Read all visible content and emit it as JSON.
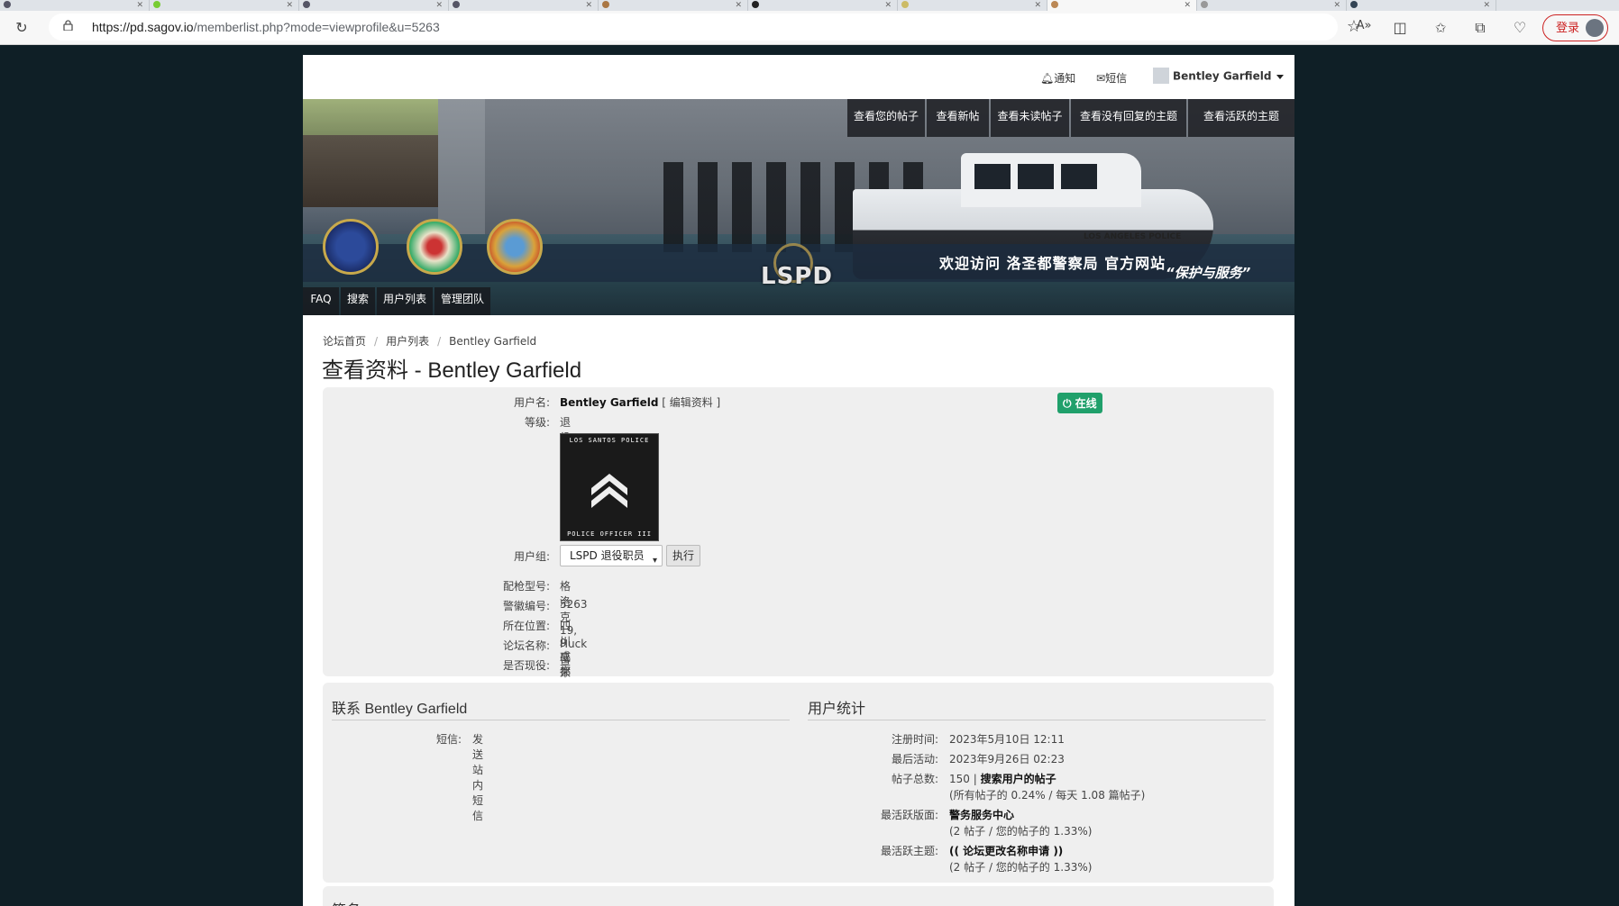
{
  "browser": {
    "url_host": "https://pd.sagov.io",
    "url_path": "/memberlist.php?mode=viewprofile&u=5263",
    "login_label": "登录"
  },
  "topnav": {
    "notifications": "通知",
    "pm": "短信",
    "username": "Bentley Garfield"
  },
  "banner": {
    "welcome": "欢迎访问 洛圣都警察局 官方网站",
    "motto": "“保护与服务”",
    "logo_text": "LSPD",
    "boat_text": "LOS ANGELES POLICE",
    "top_menu": [
      "查看您的帖子",
      "查看新帖",
      "查看未读帖子",
      "查看没有回复的主题",
      "查看活跃的主题"
    ],
    "bottom_menu": [
      "FAQ",
      "搜索",
      "用户列表",
      "管理团队"
    ]
  },
  "breadcrumb": [
    "论坛首页",
    "用户列表",
    "Bentley Garfield"
  ],
  "page_title": "查看资料 - Bentley Garfield",
  "profile": {
    "online_label": "在线",
    "username_label": "用户名:",
    "username": "Bentley Garfield",
    "edit_link": "[ 编辑资料 ]",
    "rank_label": "等级:",
    "rank": "退役三级警员",
    "rank_image_top": "LOS SANTOS POLICE",
    "rank_image_bottom": "POLICE OFFICER III",
    "group_label": "用户组:",
    "group_selected": "LSPD 退役职员",
    "go_button": "执行",
    "fields": [
      {
        "label": "配枪型号:",
        "value": "格洛克19, 9毫米"
      },
      {
        "label": "警徽编号:",
        "value": "5263"
      },
      {
        "label": "所在位置:",
        "value": "四川成都"
      },
      {
        "label": "论坛名称:",
        "value": "Huck"
      },
      {
        "label": "是否现役:",
        "value": "是"
      }
    ]
  },
  "contact": {
    "title": "联系 Bentley Garfield",
    "pm_label": "短信:",
    "pm_value": "发送站内短信"
  },
  "stats": {
    "title": "用户统计",
    "joined_label": "注册时间:",
    "joined": "2023年5月10日 12:11",
    "last_active_label": "最后活动:",
    "last_active": "2023年9月26日 02:23",
    "posts_label": "帖子总数:",
    "posts_count": "150 |",
    "posts_search": "搜索用户的帖子",
    "posts_ratio": "(所有帖子的 0.24% / 每天 1.08 篇帖子)",
    "active_forum_label": "最活跃版面:",
    "active_forum": "警务服务中心",
    "active_forum_detail": "(2 帖子 / 您的帖子的 1.33%)",
    "active_topic_label": "最活跃主题:",
    "active_topic": "(( 论坛更改名称申请 ))",
    "active_topic_detail": "(2 帖子 / 您的帖子的 1.33%)"
  },
  "signature_title": "签名"
}
